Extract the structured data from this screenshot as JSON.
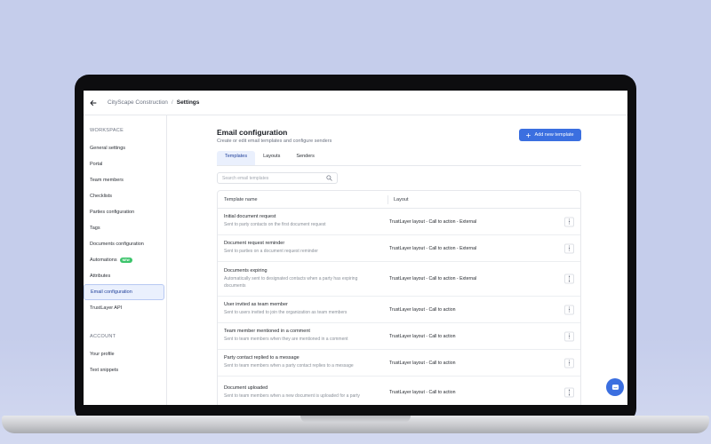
{
  "breadcrumb": {
    "parent": "CityScape Construction",
    "separator": "/",
    "current": "Settings"
  },
  "sidebar": {
    "sections": [
      {
        "title": "WORKSPACE",
        "items": [
          {
            "label": "General settings"
          },
          {
            "label": "Portal"
          },
          {
            "label": "Team members"
          },
          {
            "label": "Checklists"
          },
          {
            "label": "Parties configuration"
          },
          {
            "label": "Tags"
          },
          {
            "label": "Documents configuration"
          },
          {
            "label": "Automations",
            "badge": "NEW"
          },
          {
            "label": "Attributes"
          },
          {
            "label": "Email configuration",
            "active": true
          },
          {
            "label": "TrustLayer API"
          }
        ]
      },
      {
        "title": "ACCOUNT",
        "items": [
          {
            "label": "Your profile"
          },
          {
            "label": "Text snippets"
          }
        ]
      }
    ]
  },
  "main": {
    "title": "Email configuration",
    "subtitle": "Create or edit email templates and configure senders",
    "add_button": "Add new template",
    "tabs": [
      {
        "label": "Templates",
        "active": true
      },
      {
        "label": "Layouts"
      },
      {
        "label": "Senders"
      }
    ],
    "search_placeholder": "Search email templates",
    "table": {
      "columns": [
        "Template name",
        "Layout"
      ],
      "rows": [
        {
          "name": "Initial document request",
          "description": "Sent to party contacts on the first document request",
          "layout": "TrustLayer layout - Call to action - External"
        },
        {
          "name": "Document request reminder",
          "description": "Sent to parties on a document request reminder",
          "layout": "TrustLayer layout - Call to action - External"
        },
        {
          "name": "Documents expiring",
          "description": "Automatically sent to designated contacts when a party has expiring documents",
          "layout": "TrustLayer layout - Call to action - External"
        },
        {
          "name": "User invited as team member",
          "description": "Sent to users invited to join the organization as team members",
          "layout": "TrustLayer layout - Call to action"
        },
        {
          "name": "Team member mentioned in a comment",
          "description": "Sent to team members when they are mentioned in a comment",
          "layout": "TrustLayer layout - Call to action"
        },
        {
          "name": "Party contact replied to a message",
          "description": "Sent to team members when a party contact replies to a message",
          "layout": "TrustLayer layout - Call to action"
        },
        {
          "name": "Document uploaded",
          "description": "Sent to team members when a new document is uploaded for a party",
          "layout": "TrustLayer layout - Call to action"
        }
      ]
    }
  },
  "colors": {
    "accent": "#3b6fe0",
    "background": "#c5cdeb",
    "active_bg": "#eaf0fd",
    "badge": "#3cc46b"
  },
  "icons": {
    "back": "arrow-left-icon",
    "search": "search-icon",
    "add": "plus-icon",
    "row_menu": "kebab-menu-icon",
    "chat": "chat-icon"
  }
}
